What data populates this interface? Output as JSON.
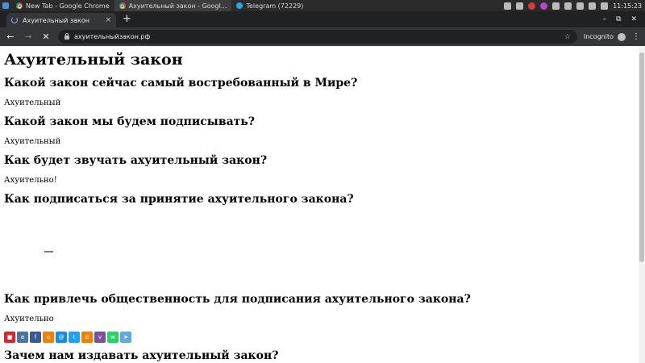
{
  "taskbar": {
    "tasks": [
      {
        "label": "New Tab - Google Chrome",
        "icon": "chrome-icon"
      },
      {
        "label": "Ахуительный закон - Googl...",
        "icon": "chrome-icon"
      },
      {
        "label": "Telegram (72229)",
        "icon": "telegram-icon"
      }
    ],
    "clock": "11:15:23"
  },
  "browser": {
    "tab_title": "Ахуительный закон",
    "tab_close": "×",
    "new_tab": "+",
    "window_controls": {
      "minimize": "–",
      "restore": "⧉",
      "close": "✕"
    },
    "url": "ахуительныйзакон.рф",
    "profile_label": "Incognito",
    "menu": "⋮"
  },
  "page": {
    "title": "Ахуительный закон",
    "sections": [
      {
        "q": "Какой закон сейчас самый востребованный в Мире?",
        "a": "Ахуительный"
      },
      {
        "q": "Какой закон мы будем подписывать?",
        "a": "Ахуительный"
      },
      {
        "q": "Как будет звучать ахуительный закон?",
        "a": "Ахуительно!"
      },
      {
        "q": "Как подписаться за принятие ахуительного закона?"
      },
      {
        "q": "Как привлечь общественность для подписания ахуительного закона?",
        "a": "Ахуительно"
      },
      {
        "q": "Зачем нам издавать ахуительный закон?"
      }
    ]
  },
  "share": [
    {
      "name": "bookmark-share-icon",
      "color": "#e0232b",
      "glyph": "■"
    },
    {
      "name": "vk-share-icon",
      "color": "#4c75a3",
      "glyph": "в"
    },
    {
      "name": "facebook-share-icon",
      "color": "#3b5998",
      "glyph": "f"
    },
    {
      "name": "odnoklassniki-share-icon",
      "color": "#ee8208",
      "glyph": "о"
    },
    {
      "name": "mailru-share-icon",
      "color": "#168de2",
      "glyph": "@"
    },
    {
      "name": "twitter-share-icon",
      "color": "#1da1f2",
      "glyph": "t"
    },
    {
      "name": "blogger-share-icon",
      "color": "#f57d00",
      "glyph": "B"
    },
    {
      "name": "viber-share-icon",
      "color": "#7b519d",
      "glyph": "v"
    },
    {
      "name": "whatsapp-share-icon",
      "color": "#25d366",
      "glyph": "w"
    },
    {
      "name": "telegram-share-icon",
      "color": "#64a9dc",
      "glyph": "➤"
    }
  ]
}
